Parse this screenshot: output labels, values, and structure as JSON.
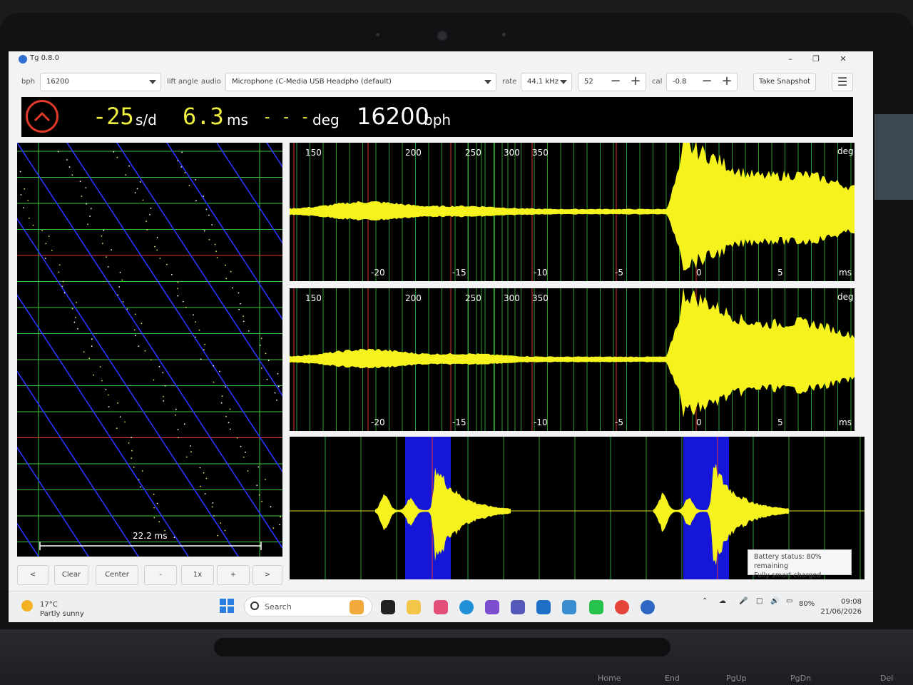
{
  "window": {
    "title": "Tg 0.8.0"
  },
  "toolbar": {
    "bph_label": "bph",
    "bph_value": "16200",
    "lift_angle_label": "lift angle",
    "audio_label": "audio",
    "audio_value": "Microphone (C-Media USB Headpho (default)",
    "rate_label": "rate",
    "rate_value": "44.1 kHz",
    "lift_angle_value": "52",
    "cal_label": "cal",
    "cal_value": "-0.8",
    "snapshot_label": "Take Snapshot"
  },
  "readout": {
    "rate": "-25",
    "rate_unit": "s/d",
    "beat_error": "6.3",
    "beat_error_unit": "ms",
    "amplitude": "- - -",
    "amplitude_unit": "deg",
    "bph": "16200",
    "bph_unit": "bph"
  },
  "paperstrip": {
    "span_label": "22.2 ms"
  },
  "waveform_panels": [
    {
      "amp_ticks": [
        "150",
        "200",
        "250",
        "300",
        "350"
      ],
      "amp_unit": "deg",
      "time_ticks": [
        "-20",
        "-15",
        "-10",
        "-5",
        "0",
        "5"
      ],
      "time_unit": "ms"
    },
    {
      "amp_ticks": [
        "150",
        "200",
        "250",
        "300",
        "350"
      ],
      "amp_unit": "deg",
      "time_ticks": [
        "-20",
        "-15",
        "-10",
        "-5",
        "0",
        "5"
      ],
      "time_unit": "ms"
    }
  ],
  "controls": {
    "left": "<",
    "clear": "Clear",
    "center": "Center",
    "minus": "-",
    "zoom": "1x",
    "plus": "+",
    "right": ">"
  },
  "battery_tooltip": {
    "line1": "Battery status: 80% remaining",
    "line2": "Fully smart charged"
  },
  "taskbar": {
    "temperature": "17°C",
    "weather": "Partly sunny",
    "search": "Search",
    "battery": "80%",
    "time": "09:08",
    "date": "21/06/2026"
  },
  "keyboard": {
    "keys": [
      "Home",
      "End",
      "PgUp",
      "PgDn",
      "Del"
    ]
  }
}
